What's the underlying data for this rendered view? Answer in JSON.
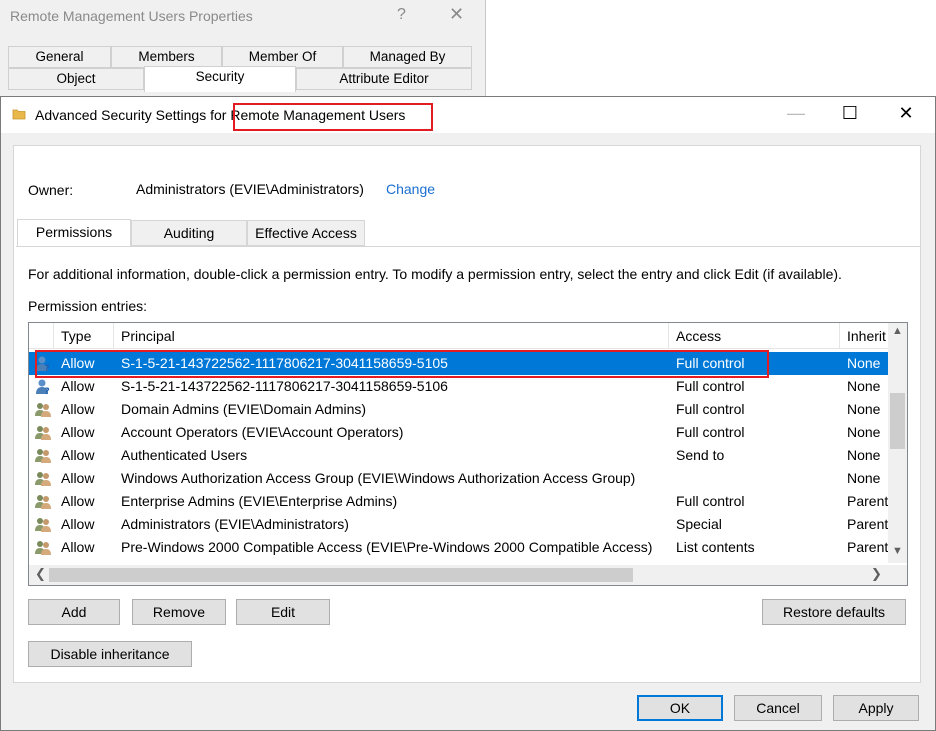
{
  "background_dialog": {
    "title": "Remote Management Users Properties",
    "help": "?",
    "close": "✕",
    "tabs_row1": [
      "General",
      "Members",
      "Member Of",
      "Managed By"
    ],
    "tabs_row2": [
      "Object",
      "Security",
      "Attribute Editor"
    ]
  },
  "dialog": {
    "title_prefix": "Advanced Security Settings for ",
    "title_object": "Remote Management Users",
    "minimize": "—",
    "maximize": "☐",
    "close": "✕"
  },
  "owner": {
    "label": "Owner:",
    "value": "Administrators (EVIE\\Administrators)",
    "change_link": "Change"
  },
  "tabs": [
    "Permissions",
    "Auditing",
    "Effective Access"
  ],
  "info_text": "For additional information, double-click a permission entry. To modify a permission entry, select the entry and click Edit (if available).",
  "entries_label": "Permission entries:",
  "columns": [
    "Type",
    "Principal",
    "Access",
    "Inherit"
  ],
  "rows": [
    {
      "type": "Allow",
      "principal": "S-1-5-21-143722562-1117806217-3041158659-5105",
      "access": "Full control",
      "inherit": "None",
      "icon": "unknown-user-icon"
    },
    {
      "type": "Allow",
      "principal": "S-1-5-21-143722562-1117806217-3041158659-5106",
      "access": "Full control",
      "inherit": "None",
      "icon": "unknown-user-icon"
    },
    {
      "type": "Allow",
      "principal": "Domain Admins (EVIE\\Domain Admins)",
      "access": "Full control",
      "inherit": "None",
      "icon": "group-icon"
    },
    {
      "type": "Allow",
      "principal": "Account Operators (EVIE\\Account Operators)",
      "access": "Full control",
      "inherit": "None",
      "icon": "group-icon"
    },
    {
      "type": "Allow",
      "principal": "Authenticated Users",
      "access": "Send to",
      "inherit": "None",
      "icon": "group-icon"
    },
    {
      "type": "Allow",
      "principal": "Windows Authorization Access Group (EVIE\\Windows Authorization Access Group)",
      "access": "",
      "inherit": "None",
      "icon": "group-icon"
    },
    {
      "type": "Allow",
      "principal": "Enterprise Admins (EVIE\\Enterprise Admins)",
      "access": "Full control",
      "inherit": "Parent",
      "icon": "group-icon"
    },
    {
      "type": "Allow",
      "principal": "Administrators (EVIE\\Administrators)",
      "access": "Special",
      "inherit": "Parent",
      "icon": "group-icon"
    },
    {
      "type": "Allow",
      "principal": "Pre-Windows 2000 Compatible Access (EVIE\\Pre-Windows 2000 Compatible Access)",
      "access": "List contents",
      "inherit": "Parent",
      "icon": "group-icon"
    }
  ],
  "buttons": {
    "add": "Add",
    "remove": "Remove",
    "edit": "Edit",
    "restore_defaults": "Restore defaults",
    "disable_inheritance": "Disable inheritance",
    "ok": "OK",
    "cancel": "Cancel",
    "apply": "Apply"
  },
  "colors": {
    "selection": "#0078d7",
    "highlight_box": "#e31b23",
    "link": "#1a6fd0"
  }
}
